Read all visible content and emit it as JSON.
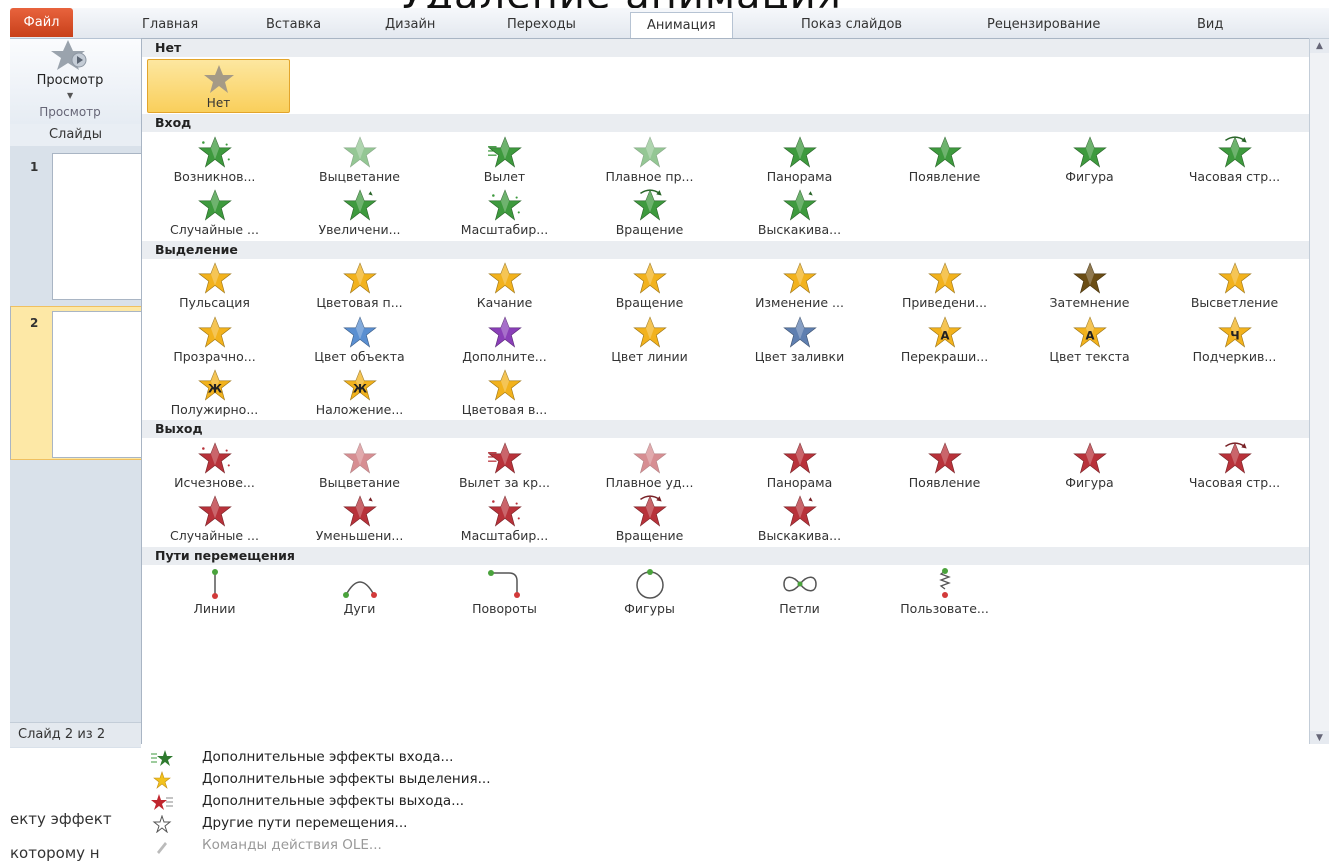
{
  "background_title": "Удаление анимация",
  "ribbon": {
    "tabs": [
      "Файл",
      "Главная",
      "Вставка",
      "Дизайн",
      "Переходы",
      "Анимация",
      "Показ слайдов",
      "Рецензирование",
      "Вид"
    ],
    "active_tab": "Анимация"
  },
  "preview": {
    "button_label": "Просмотр",
    "group_label": "Просмотр"
  },
  "slides_panel": {
    "header": "Слайды",
    "thumbnails": [
      "1",
      "2"
    ],
    "selected": "2",
    "status": "Слайд 2 из 2",
    "below_text_1": "екту эффект",
    "below_text_2": "которому н"
  },
  "gallery": {
    "sections": {
      "none": {
        "title": "Нет",
        "items": [
          "Нет"
        ]
      },
      "entrance": {
        "title": "Вход",
        "color": "#3e9a3e",
        "items": [
          "Возникнов...",
          "Выцветание",
          "Вылет",
          "Плавное пр...",
          "Панорама",
          "Появление",
          "Фигура",
          "Часовая стр...",
          "Случайные ...",
          "Увеличени...",
          "Масштабир...",
          "Вращение",
          "Выскакива..."
        ]
      },
      "emphasis": {
        "title": "Выделение",
        "color": "#f2b21d",
        "items": [
          "Пульсация",
          "Цветовая п...",
          "Качание",
          "Вращение",
          "Изменение ...",
          "Приведени...",
          "Затемнение",
          "Высветление",
          "Прозрачно...",
          "Цвет объекта",
          "Дополните...",
          "Цвет линии",
          "Цвет заливки",
          "Перекраши...",
          "Цвет текста",
          "Подчеркив...",
          "Полужирно...",
          "Наложение...",
          "Цветовая в..."
        ]
      },
      "emphasis_glyphs": {
        "underline": "Ч",
        "bold": "Ж",
        "overlay": "Ж",
        "recolor": "A",
        "text_color": "A"
      },
      "exit": {
        "title": "Выход",
        "color": "#b8323a",
        "items": [
          "Исчезнове...",
          "Выцветание",
          "Вылет за кр...",
          "Плавное уд...",
          "Панорама",
          "Появление",
          "Фигура",
          "Часовая стр...",
          "Случайные ...",
          "Уменьшени...",
          "Масштабир...",
          "Вращение",
          "Выскакива..."
        ]
      },
      "paths": {
        "title": "Пути перемещения",
        "items": [
          "Линии",
          "Дуги",
          "Повороты",
          "Фигуры",
          "Петли",
          "Пользовате..."
        ]
      }
    }
  },
  "more_menu": {
    "items": [
      {
        "label": "Дополнительные эффекты входа...",
        "icon": "entrance-effects-icon",
        "enabled": true
      },
      {
        "label": "Дополнительные эффекты выделения...",
        "icon": "emphasis-effects-icon",
        "enabled": true
      },
      {
        "label": "Дополнительные эффекты выхода...",
        "icon": "exit-effects-icon",
        "enabled": true
      },
      {
        "label": "Другие пути перемещения...",
        "icon": "motion-paths-icon",
        "enabled": true
      },
      {
        "label": "Команды действия OLE...",
        "icon": "ole-action-icon",
        "enabled": false
      }
    ]
  }
}
